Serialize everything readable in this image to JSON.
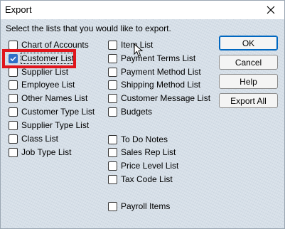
{
  "dialog": {
    "title": "Export",
    "instruction": "Select the lists that you would like to export."
  },
  "lists": {
    "left": [
      {
        "label": "Chart of Accounts",
        "checked": false
      },
      {
        "label": "Customer List",
        "checked": true
      },
      {
        "label": "Supplier List",
        "checked": false
      },
      {
        "label": "Employee List",
        "checked": false
      },
      {
        "label": "Other Names List",
        "checked": false
      },
      {
        "label": "Customer Type List",
        "checked": false
      },
      {
        "label": "Supplier Type List",
        "checked": false
      },
      {
        "label": "Class List",
        "checked": false
      },
      {
        "label": "Job Type List",
        "checked": false
      }
    ],
    "right": [
      {
        "label": "Item List",
        "checked": false
      },
      {
        "label": "Payment Terms List",
        "checked": false
      },
      {
        "label": "Payment Method List",
        "checked": false
      },
      {
        "label": "Shipping Method List",
        "checked": false
      },
      {
        "label": "Customer Message List",
        "checked": false
      },
      {
        "label": "Budgets",
        "checked": false
      },
      {
        "label": "To Do Notes",
        "checked": false
      },
      {
        "label": "Sales Rep List",
        "checked": false
      },
      {
        "label": "Price Level List",
        "checked": false
      },
      {
        "label": "Tax Code List",
        "checked": false
      },
      {
        "label": "Payroll Items",
        "checked": false
      }
    ]
  },
  "buttons": {
    "ok": "OK",
    "cancel": "Cancel",
    "help": "Help",
    "export_all": "Export All"
  },
  "colors": {
    "accent": "#2f6fc7",
    "highlight": "#e0151c",
    "background": "#d6dfe8"
  },
  "icons": {
    "close": "close-icon",
    "check": "checkmark-icon",
    "cursor": "mouse-pointer-icon"
  }
}
